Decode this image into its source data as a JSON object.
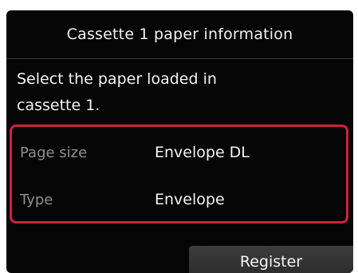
{
  "header": {
    "title": "Cassette 1 paper information"
  },
  "message": {
    "line1": "Select the paper loaded in",
    "line2": "cassette 1."
  },
  "settings": {
    "rows": [
      {
        "label": "Page size",
        "value": "Envelope DL"
      },
      {
        "label": "Type",
        "value": "Envelope"
      }
    ],
    "highlight_color": "#d3203a"
  },
  "actions": {
    "register_label": "Register"
  }
}
